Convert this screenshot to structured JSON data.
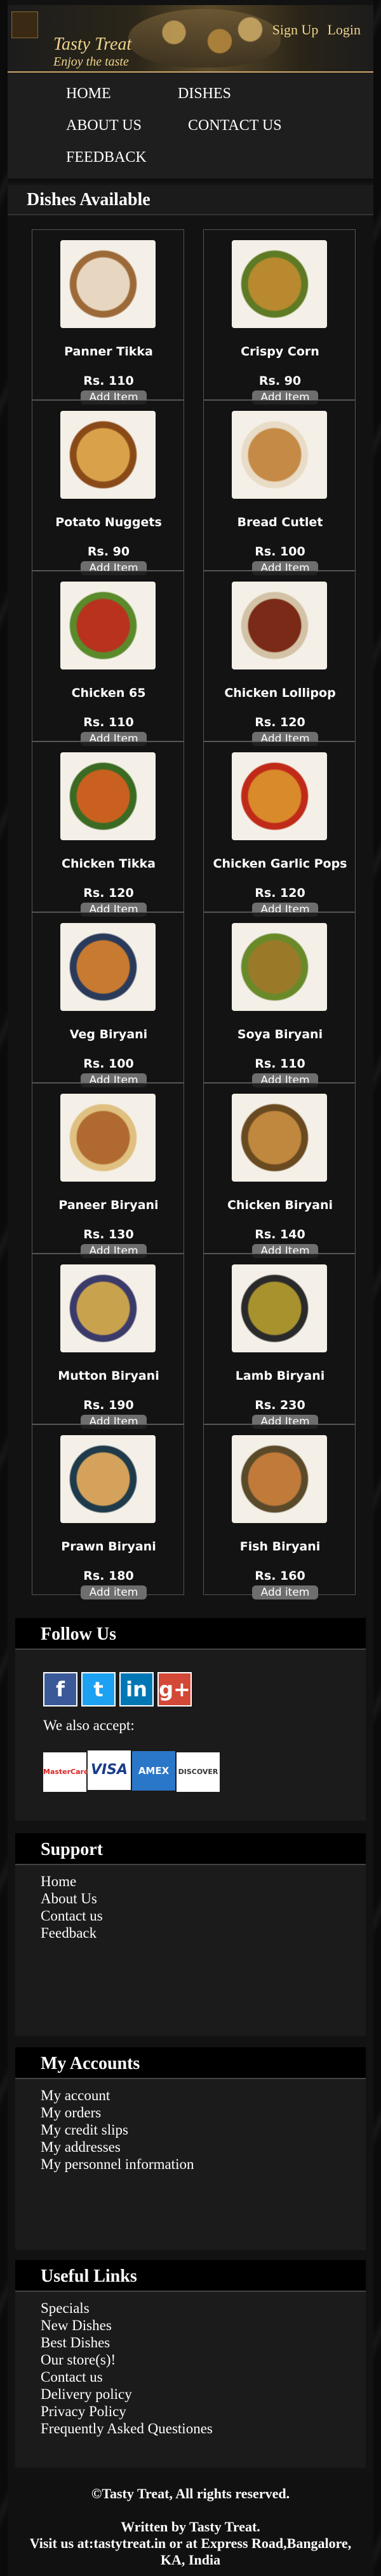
{
  "header": {
    "brand": "Tasty Treat",
    "tagline": "Enjoy the taste",
    "signup": "Sign Up",
    "login": "Login"
  },
  "nav": {
    "home": "HOME",
    "dishes": "DISHES",
    "about": "ABOUT US",
    "contact": "CONTACT US",
    "feedback": "FEEDBACK"
  },
  "dishes_heading": "Dishes Available",
  "dishes": [
    {
      "name": "Panner Tikka",
      "price": "Rs. 110",
      "button": "Add Item"
    },
    {
      "name": "Crispy Corn",
      "price": "Rs. 90",
      "button": "Add Item"
    },
    {
      "name": "Potato Nuggets",
      "price": "Rs. 90",
      "button": "Add Item"
    },
    {
      "name": "Bread Cutlet",
      "price": "Rs. 100",
      "button": "Add Item"
    },
    {
      "name": "Chicken 65",
      "price": "Rs. 110",
      "button": "Add Item"
    },
    {
      "name": "Chicken Lollipop",
      "price": "Rs. 120",
      "button": "Add Item"
    },
    {
      "name": "Chicken Tikka",
      "price": "Rs. 120",
      "button": "Add Item"
    },
    {
      "name": "Chicken Garlic Pops",
      "price": "Rs. 120",
      "button": "Add Item"
    },
    {
      "name": "Veg Biryani",
      "price": "Rs. 100",
      "button": "Add Item"
    },
    {
      "name": "Soya Biryani",
      "price": "Rs. 110",
      "button": "Add Item"
    },
    {
      "name": "Paneer Biryani",
      "price": "Rs. 130",
      "button": "Add Item"
    },
    {
      "name": "Chicken Biryani",
      "price": "Rs. 140",
      "button": "Add Item"
    },
    {
      "name": "Mutton Biryani",
      "price": "Rs. 190",
      "button": "Add Item"
    },
    {
      "name": "Lamb Biryani",
      "price": "Rs. 230",
      "button": "Add Item"
    },
    {
      "name": "Prawn Biryani",
      "price": "Rs. 180",
      "button": "Add item"
    },
    {
      "name": "Fish Biryani",
      "price": "Rs. 160",
      "button": "Add item"
    }
  ],
  "follow": {
    "title": "Follow Us",
    "social": [
      "f",
      "t",
      "in",
      "g+"
    ],
    "accept": "We also accept:",
    "cards": [
      "MasterCard",
      "VISA",
      "AMEX",
      "DISCOVER"
    ]
  },
  "support": {
    "title": "Support",
    "links": [
      "Home",
      "About Us",
      "Contact us",
      "Feedback"
    ]
  },
  "accounts": {
    "title": "My Accounts",
    "links": [
      "My account",
      "My orders",
      "My credit slips",
      "My addresses",
      "My personnel information"
    ]
  },
  "useful": {
    "title": "Useful Links",
    "links": [
      "Specials",
      "New Dishes",
      "Best Dishes",
      "Our store(s)!",
      "Contact us",
      "Delivery policy",
      "Privacy Policy",
      "Frequently Asked Questiones"
    ]
  },
  "footer": {
    "copyright": "©Tasty Treat, All rights reserved.",
    "written_by": "Written by Tasty Treat.",
    "visit": "Visit us at:tastytreat.in or at Express Road,Bangalore, KA, India"
  },
  "colors": {
    "gold": "#f0d48a",
    "price_gold": "#ffffff",
    "button_gray": "#6e6e6e"
  }
}
